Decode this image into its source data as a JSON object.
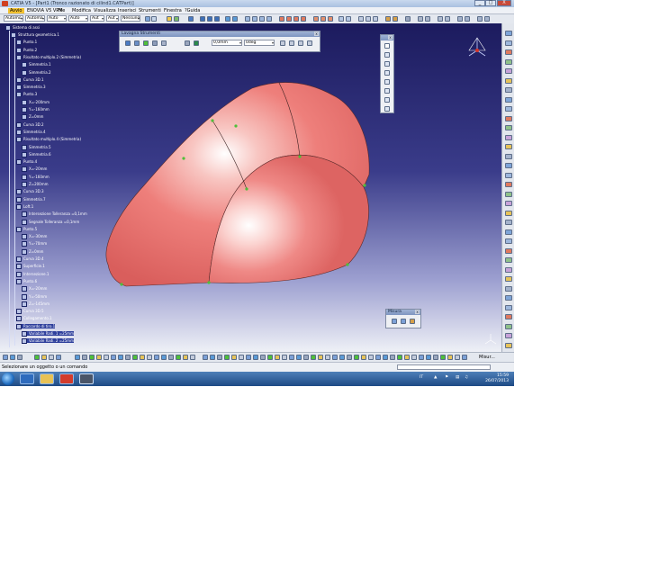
{
  "window": {
    "title": "CATIA V5 - [Part1 (Tronco razionato di cilind1.CATPart)]",
    "buttons": [
      "_",
      "□",
      "X"
    ]
  },
  "menu": [
    "Avvio",
    "ENOVIA V5 VPM",
    "File",
    "Modifica",
    "Visualizza",
    "Inserisci",
    "Strumenti",
    "Finestra",
    "?Guida"
  ],
  "toolbar_combos": [
    "Automo",
    "Automa",
    "Auto",
    "Auto",
    "Aut",
    "Aut",
    "Nessuno"
  ],
  "tree": {
    "root": "Sistema di assi",
    "nodes": [
      {
        "label": "Struttura geometrica.1",
        "depth": 1
      },
      {
        "label": "Punto.1",
        "depth": 2
      },
      {
        "label": "Punto.2",
        "depth": 2
      },
      {
        "label": "Risultato multiplo.2 (Simmetria)",
        "depth": 2
      },
      {
        "label": "Simmetria.1",
        "depth": 3
      },
      {
        "label": "Simmetria.2",
        "depth": 3
      },
      {
        "label": "Curva 3D.1",
        "depth": 2
      },
      {
        "label": "Simmetria.3",
        "depth": 2
      },
      {
        "label": "Punto.3",
        "depth": 2
      },
      {
        "label": "X=-200mm",
        "depth": 3
      },
      {
        "label": "Y=-160mm",
        "depth": 3
      },
      {
        "label": "Z=0mm",
        "depth": 3
      },
      {
        "label": "Curva 3D.2",
        "depth": 2
      },
      {
        "label": "Simmetria.4",
        "depth": 2
      },
      {
        "label": "Risultato multiplo.4 (Simmetria)",
        "depth": 2
      },
      {
        "label": "Simmetria.5",
        "depth": 3
      },
      {
        "label": "Simmetria.6",
        "depth": 3
      },
      {
        "label": "Punto.4",
        "depth": 2
      },
      {
        "label": "X=-20mm",
        "depth": 3
      },
      {
        "label": "Y=-160mm",
        "depth": 3
      },
      {
        "label": "Z=200mm",
        "depth": 3
      },
      {
        "label": "Curva 3D.3",
        "depth": 2
      },
      {
        "label": "Simmetria.7",
        "depth": 2
      },
      {
        "label": "Loft.1",
        "depth": 2
      },
      {
        "label": "Intersezione Tolleranza =0,1mm",
        "depth": 3
      },
      {
        "label": "Segnale Tolleranza =0,1mm",
        "depth": 3
      },
      {
        "label": "Punto.5",
        "depth": 2
      },
      {
        "label": "X=-30mm",
        "depth": 3
      },
      {
        "label": "Y=-70mm",
        "depth": 3
      },
      {
        "label": "Z=0mm",
        "depth": 3
      },
      {
        "label": "Curva 3D.4",
        "depth": 2
      },
      {
        "label": "Superficie.1",
        "depth": 2
      },
      {
        "label": "Intersezione.1",
        "depth": 2
      },
      {
        "label": "Punto.6",
        "depth": 2
      },
      {
        "label": "X=-20mm",
        "depth": 3
      },
      {
        "label": "Y=-50mm",
        "depth": 3
      },
      {
        "label": "Z=-145mm",
        "depth": 3
      },
      {
        "label": "Curva 3D.5",
        "depth": 2
      },
      {
        "label": "Collegamento.1",
        "depth": 2
      },
      {
        "label": "Raccordo di tiro.1",
        "depth": 2
      },
      {
        "label": "Variabile Radi. 1 =25mm",
        "depth": 3
      },
      {
        "label": "Variabile Radi. 2 =25mm",
        "depth": 3
      }
    ]
  },
  "floating_toolbar": {
    "title": "Lavagna Strumenti",
    "combo1": "0,0mm",
    "combo2": "0deg"
  },
  "measure_toolbar": {
    "title": "Misura"
  },
  "status": {
    "text": "Selezionare un oggetto o un comando",
    "measure_label": "Misur..."
  },
  "taskbar": {
    "lang": "IT",
    "time": "15:59",
    "date": "26/07/2013"
  },
  "colors": {
    "surface": "#f07b79",
    "points": "#4fbf3a",
    "viewport_top": "#1c1b5e",
    "viewport_bottom": "#eef0f6"
  }
}
